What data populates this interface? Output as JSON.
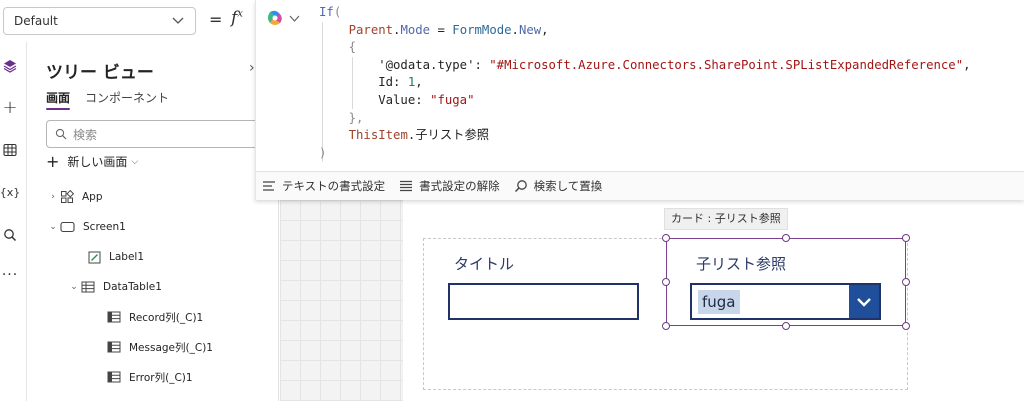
{
  "property_selector": {
    "value": "Default"
  },
  "formula_bar": {
    "equals": "=",
    "fx": "f",
    "fx_sup": "x",
    "code_lines": [
      "If(",
      "    Parent.Mode = FormMode.New,",
      "    {",
      "        '@odata.type': \"#Microsoft.Azure.Connectors.SharePoint.SPListExpandedReference\",",
      "        Id: 1,",
      "        Value: \"fuga\"",
      "    },",
      "    ThisItem.子リスト参照",
      ")"
    ]
  },
  "format_toolbar": {
    "format_text": "テキストの書式設定",
    "remove_format": "書式設定の解除",
    "find_replace": "検索して置換"
  },
  "left_rail": {
    "icons": [
      "layers-icon",
      "plus-icon",
      "table-icon",
      "variables-icon",
      "search-icon",
      "more-icon"
    ],
    "variables_glyph": "{x}"
  },
  "tree_view": {
    "title": "ツリー ビュー",
    "tabs": [
      "画面",
      "コンポーネント"
    ],
    "search_placeholder": "検索",
    "new_screen": "新しい画面",
    "nodes": [
      {
        "label": "App"
      },
      {
        "label": "Screen1"
      },
      {
        "label": "Label1"
      },
      {
        "label": "DataTable1"
      },
      {
        "label": "Record列(_C)1"
      },
      {
        "label": "Message列(_C)1"
      },
      {
        "label": "Error列(_C)1"
      }
    ]
  },
  "canvas": {
    "tooltip": "カード : 子リスト参照",
    "card1_label": "タイトル",
    "card2_label": "子リスト参照",
    "combo_value": "fuga"
  },
  "colors": {
    "accent": "#6b2f8f",
    "form_border": "#1f3368",
    "combo_button": "#1f4f9b"
  }
}
